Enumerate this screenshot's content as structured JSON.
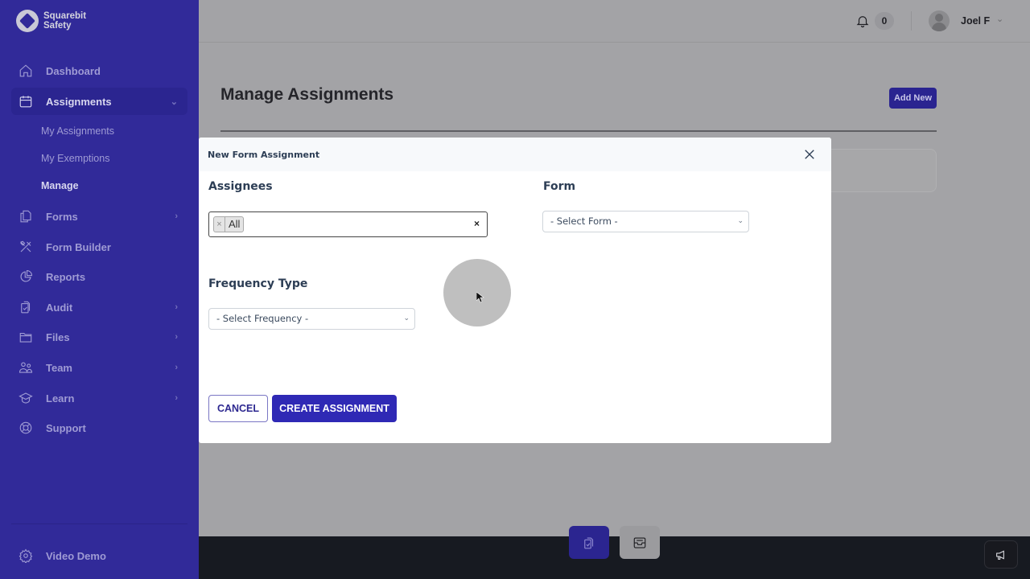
{
  "brand": {
    "name_line1": "Squarebit",
    "name_line2": "Safety"
  },
  "sidebar": {
    "items": [
      {
        "label": "Dashboard",
        "icon": "home-icon"
      },
      {
        "label": "Assignments",
        "icon": "calendar-icon",
        "expanded": true,
        "children": [
          {
            "label": "My Assignments"
          },
          {
            "label": "My Exemptions"
          },
          {
            "label": "Manage",
            "current": true
          }
        ]
      },
      {
        "label": "Forms",
        "icon": "documents-icon",
        "has_submenu": true
      },
      {
        "label": "Form Builder",
        "icon": "tools-icon"
      },
      {
        "label": "Reports",
        "icon": "pie-chart-icon"
      },
      {
        "label": "Audit",
        "icon": "clipboard-check-icon",
        "has_submenu": true
      },
      {
        "label": "Files",
        "icon": "folder-icon",
        "has_submenu": true
      },
      {
        "label": "Team",
        "icon": "users-icon",
        "has_submenu": true
      },
      {
        "label": "Learn",
        "icon": "graduation-cap-icon",
        "has_submenu": true
      },
      {
        "label": "Support",
        "icon": "lifebuoy-icon"
      }
    ],
    "footer_item": {
      "label": "Video Demo",
      "icon": "gear-icon"
    }
  },
  "header": {
    "notification_count": "0",
    "user_name": "Joel F"
  },
  "page": {
    "title": "Manage Assignments",
    "add_new_label": "Add New"
  },
  "modal": {
    "title": "New Form Assignment",
    "assignees": {
      "label": "Assignees",
      "selected": [
        "All"
      ],
      "clear_symbol": "×",
      "chip_remove_symbol": "×"
    },
    "form": {
      "label": "Form",
      "selected": "- Select Form -"
    },
    "frequency": {
      "label": "Frequency Type",
      "selected": "- Select Frequency -"
    },
    "cancel_label": "CANCEL",
    "create_label": "CREATE ASSIGNMENT"
  },
  "colors": {
    "sidebar_bg": "#312a99",
    "primary": "#2f29b5",
    "footer_bg": "#171a21",
    "overlay_bg": "#a3a3a6",
    "label_text": "#2d3e55"
  }
}
